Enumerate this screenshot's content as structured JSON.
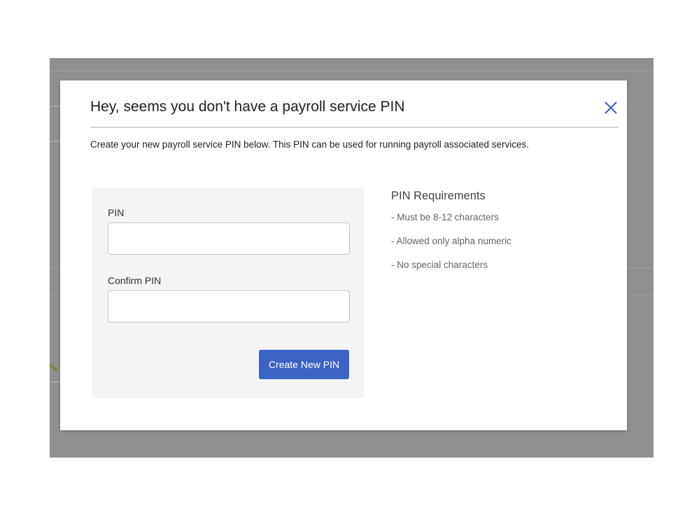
{
  "modal": {
    "title": "Hey, seems you don't have a payroll service PIN",
    "close_icon": "close-icon",
    "description": "Create your new payroll service PIN below. This PIN can be used for running payroll associated services."
  },
  "form": {
    "pin_label": "PIN",
    "pin_value": "",
    "pin_placeholder": "",
    "confirm_label": "Confirm PIN",
    "confirm_value": "",
    "confirm_placeholder": "",
    "submit_label": "Create New PIN"
  },
  "requirements": {
    "heading": "PIN Requirements",
    "items": [
      "- Must be 8-12 characters",
      "- Allowed only alpha numeric",
      "- No special characters"
    ]
  },
  "colors": {
    "accent": "#3b63c4",
    "overlay": "#8f8f8f",
    "panel": "#f4f4f4"
  }
}
